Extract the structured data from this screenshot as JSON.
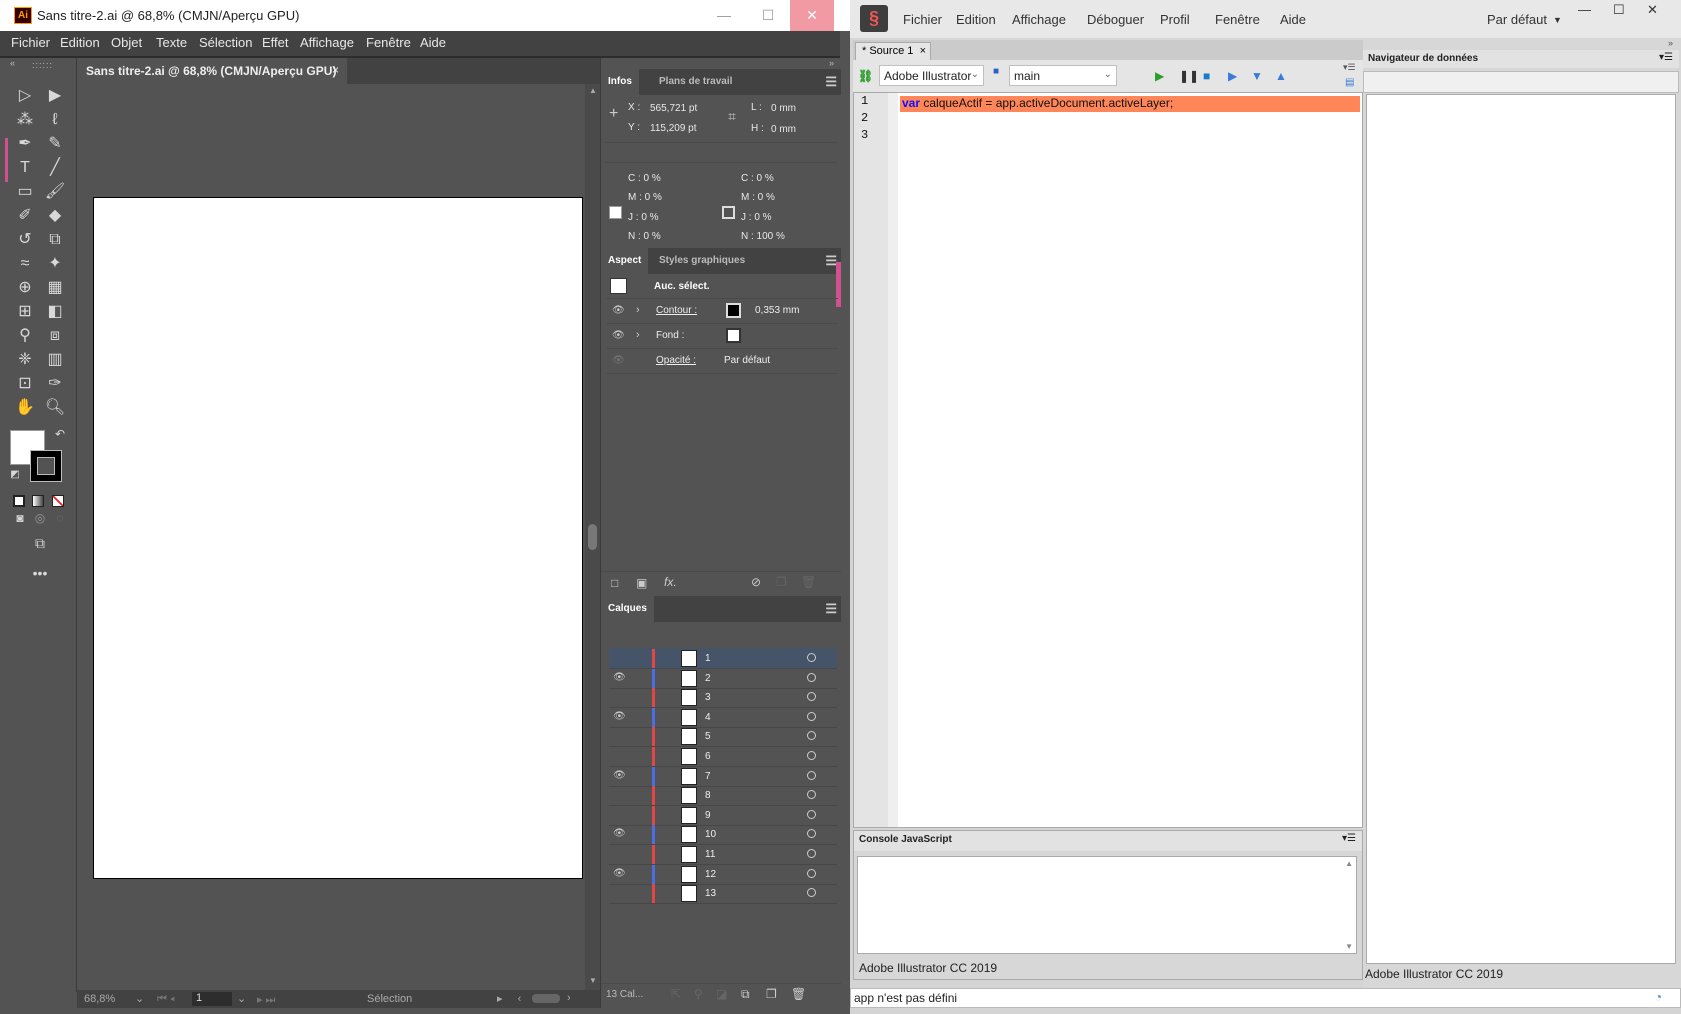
{
  "ai": {
    "window_title": "Sans titre-2.ai @ 68,8% (CMJN/Aperçu GPU)",
    "logo_text": "Ai",
    "menu": [
      "Fichier",
      "Edition",
      "Objet",
      "Texte",
      "Sélection",
      "Effet",
      "Affichage",
      "Fenêtre",
      "Aide"
    ],
    "doc_tab": "Sans titre-2.ai @ 68,8% (CMJN/Aperçu GPU)",
    "doc_tab_close": "×",
    "status": {
      "zoom": "68,8%",
      "artboard": "1",
      "tool": "Sélection"
    },
    "infos": {
      "tab_active": "Infos",
      "tab_other": "Plans de travail",
      "x_label": "X :",
      "x_value": "565,721 pt",
      "y_label": "Y :",
      "y_value": "115,209 pt",
      "l_label": "L :",
      "l_value": "0 mm",
      "h_label": "H :",
      "h_value": "0 mm",
      "fill": {
        "c": "C : 0 %",
        "m": "M : 0 %",
        "j": "J : 0 %",
        "n": "N : 0 %"
      },
      "stroke": {
        "c": "C : 0 %",
        "m": "M : 0 %",
        "j": "J : 0 %",
        "n": "N : 100 %"
      }
    },
    "aspect": {
      "tab_active": "Aspect",
      "tab_other": "Styles graphiques",
      "selection": "Auc. sélect.",
      "contour_label": "Contour :",
      "contour_value": "0,353 mm",
      "fond_label": "Fond :",
      "opacity_label": "Opacité :",
      "opacity_value": "Par défaut"
    },
    "layers": {
      "tab": "Calques",
      "footer": "13 Cal...",
      "items": [
        {
          "name": "1",
          "visible": false,
          "color": "#e04848",
          "selected": true
        },
        {
          "name": "2",
          "visible": true,
          "color": "#4b6ee0"
        },
        {
          "name": "3",
          "visible": false,
          "color": "#e04848"
        },
        {
          "name": "4",
          "visible": true,
          "color": "#4b6ee0"
        },
        {
          "name": "5",
          "visible": false,
          "color": "#e04848"
        },
        {
          "name": "6",
          "visible": false,
          "color": "#e04848"
        },
        {
          "name": "7",
          "visible": true,
          "color": "#4b6ee0"
        },
        {
          "name": "8",
          "visible": false,
          "color": "#e04848"
        },
        {
          "name": "9",
          "visible": false,
          "color": "#e04848"
        },
        {
          "name": "10",
          "visible": true,
          "color": "#4b6ee0"
        },
        {
          "name": "11",
          "visible": false,
          "color": "#e04848"
        },
        {
          "name": "12",
          "visible": true,
          "color": "#4b6ee0"
        },
        {
          "name": "13",
          "visible": false,
          "color": "#e04848"
        }
      ]
    }
  },
  "estk": {
    "menu": [
      "Fichier",
      "Edition",
      "Affichage",
      "Déboguer",
      "Profil",
      "Fenêtre",
      "Aide"
    ],
    "workspace": "Par défaut",
    "source_tab": "* Source 1",
    "source_tab_close": "×",
    "target_app": "Adobe Illustrator",
    "target_engine": "main",
    "line_numbers": [
      "1",
      "2",
      "3"
    ],
    "code_keyword": "var",
    "code_rest": " calqueActif = app.activeDocument.activeLayer;",
    "console_title": "Console JavaScript",
    "console_footer": "Adobe Illustrator CC 2019",
    "navigator_title": "Navigateur de données",
    "navigator_footer": "Adobe Illustrator CC 2019",
    "status_message": "app n'est pas défini"
  }
}
